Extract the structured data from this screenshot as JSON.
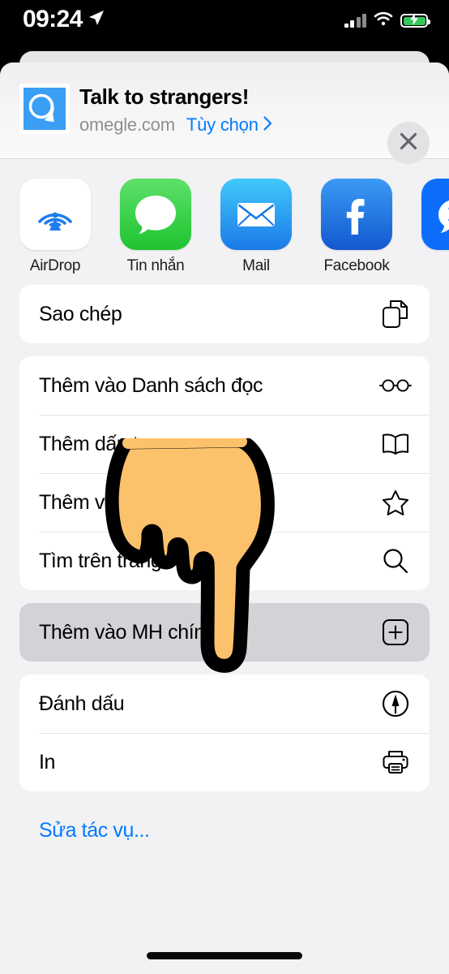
{
  "status_bar": {
    "time": "09:24",
    "location_icon": "location-arrow-icon",
    "signal_icon": "cellular-signal-icon",
    "wifi_icon": "wifi-icon",
    "battery_icon": "battery-charging-icon",
    "battery_color": "#34c759"
  },
  "header": {
    "favicon_name": "omegle-favicon",
    "title": "Talk to strangers!",
    "domain": "omegle.com",
    "options_label": "Tùy chọn",
    "options_chevron": "chevron-right-icon",
    "options_color": "#017aff",
    "close_icon": "close-icon"
  },
  "apps": [
    {
      "label": "AirDrop",
      "icon": "airdrop-icon",
      "bg": "#ffffff"
    },
    {
      "label": "Tin nhắn",
      "icon": "messages-icon",
      "bg": "#3cc74a"
    },
    {
      "label": "Mail",
      "icon": "mail-icon",
      "bg": "#2196f3"
    },
    {
      "label": "Facebook",
      "icon": "facebook-icon",
      "bg": "#1877f2"
    },
    {
      "label": "",
      "icon": "zalo-icon",
      "bg": "#0d6efd"
    }
  ],
  "action_groups": [
    {
      "rows": [
        {
          "label": "Sao chép",
          "icon": "copy-icon",
          "highlighted": false
        }
      ]
    },
    {
      "rows": [
        {
          "label": "Thêm vào Danh sách đọc",
          "icon": "glasses-icon",
          "highlighted": false
        },
        {
          "label": "Thêm dấu trang",
          "icon": "book-icon",
          "highlighted": false
        },
        {
          "label": "Thêm vào Mục ưa thích",
          "icon": "star-icon",
          "highlighted": false
        },
        {
          "label": "Tìm trên trang",
          "icon": "search-icon",
          "highlighted": false
        }
      ]
    },
    {
      "rows": [
        {
          "label": "Thêm vào MH chính",
          "icon": "plus-square-icon",
          "highlighted": true
        }
      ]
    },
    {
      "rows": [
        {
          "label": "Đánh dấu",
          "icon": "markup-pen-icon",
          "highlighted": false
        },
        {
          "label": "In",
          "icon": "printer-icon",
          "highlighted": false
        }
      ]
    }
  ],
  "edit_actions_label": "Sửa tác vụ...",
  "cursor": {
    "icon": "pointing-hand-cursor",
    "fill": "#fcc26b",
    "outline": "#000000"
  }
}
